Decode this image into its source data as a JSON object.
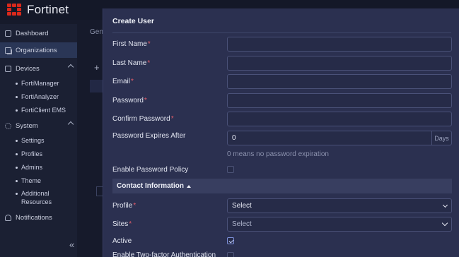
{
  "brand": {
    "name": "Fortinet"
  },
  "sidebar": {
    "items": [
      {
        "label": "Dashboard",
        "icon": "chart-icon"
      },
      {
        "label": "Organizations",
        "icon": "organizations-icon",
        "active": true
      },
      {
        "label": "Devices",
        "icon": "devices-icon",
        "expanded": true
      },
      {
        "label": "System",
        "icon": "system-icon",
        "expanded": true
      },
      {
        "label": "Notifications",
        "icon": "bell-icon"
      }
    ],
    "devices_sub": [
      "FortiManager",
      "FortiAnalyzer",
      "FortiClient EMS"
    ],
    "system_sub": [
      "Settings",
      "Profiles",
      "Admins",
      "Theme",
      "Additional Resources"
    ],
    "collapse_symbol": "«"
  },
  "background": {
    "tab_fragment": "Gen",
    "add_symbol": "+"
  },
  "dialog": {
    "title": "Create User",
    "fields": {
      "first_name": {
        "label": "First Name",
        "required": "*",
        "value": ""
      },
      "last_name": {
        "label": "Last Name",
        "required": "*",
        "value": ""
      },
      "email": {
        "label": "Email",
        "required": "*",
        "value": ""
      },
      "password": {
        "label": "Password",
        "required": "*",
        "value": ""
      },
      "confirm_password": {
        "label": "Confirm Password",
        "required": "*",
        "value": ""
      },
      "password_expires": {
        "label": "Password Expires After",
        "value": "0",
        "unit": "Days",
        "hint": "0 means no password expiration"
      },
      "password_policy": {
        "label": "Enable Password Policy",
        "checked": false
      }
    },
    "section": {
      "label": "Contact Information"
    },
    "profile": {
      "label": "Profile",
      "required": "*",
      "value": "Select"
    },
    "sites": {
      "label": "Sites",
      "required": "*",
      "placeholder": "Select"
    },
    "active": {
      "label": "Active",
      "checked": true
    },
    "two_factor": {
      "label": "Enable Two-factor Authentication"
    }
  },
  "colors": {
    "accent": "#2a3656",
    "brand_red": "#da291c",
    "required": "#e35d6a",
    "dialog_bg": "#2b3050"
  }
}
